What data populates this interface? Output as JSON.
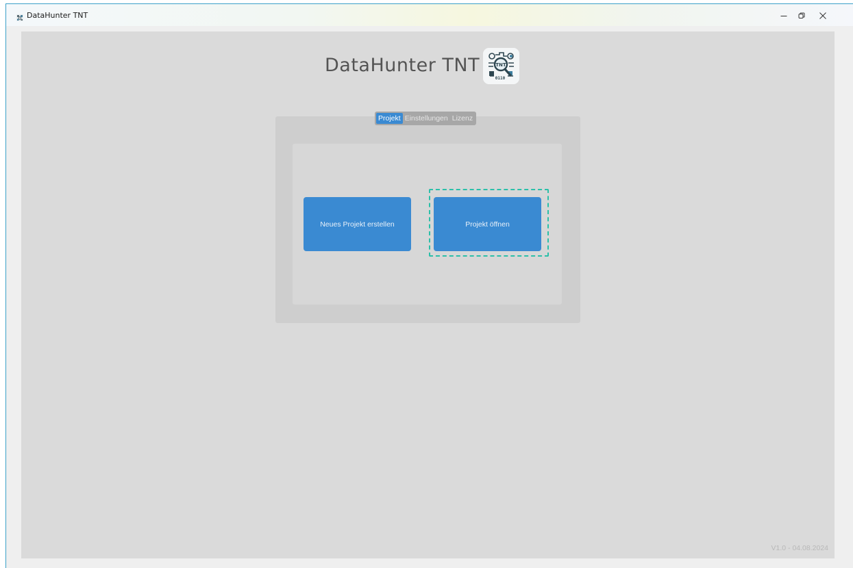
{
  "window": {
    "title": "DataHunter TNT",
    "controls": {
      "minimize_icon": "minimize-icon",
      "restore_icon": "restore-icon",
      "close_icon": "close-icon"
    }
  },
  "header": {
    "title": "DataHunter TNT",
    "logo_icon": "datahunter-logo-icon"
  },
  "tabs": [
    {
      "label": "Projekt",
      "active": true
    },
    {
      "label": "Einstellungen",
      "active": false
    },
    {
      "label": "Lizenz",
      "active": false
    }
  ],
  "actions": {
    "new_project_label": "Neues Projekt erstellen",
    "open_project_label": "Projekt öffnen",
    "focused": "open_project"
  },
  "footer": {
    "version": "V1.0 - 04.08.2024"
  },
  "colors": {
    "accent": "#3a8ad2",
    "focus_ring": "#2bbfa8",
    "background": "#dadada",
    "panel": "#cecece"
  }
}
